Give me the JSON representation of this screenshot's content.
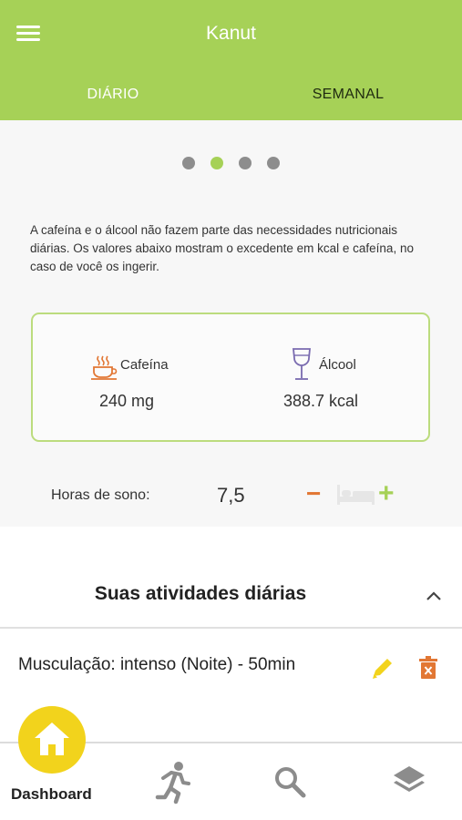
{
  "app": {
    "title": "Kanut"
  },
  "tabs": [
    {
      "label": "DIÁRIO",
      "active": true
    },
    {
      "label": "SEMANAL",
      "active": false
    }
  ],
  "carousel": {
    "page_count": 4,
    "active_index": 1
  },
  "intro_text": "A cafeína e o álcool não fazem parte das necessidades nutricionais diárias. Os valores abaixo mostram o excedente em kcal e cafeína, no caso de você os ingerir.",
  "intake_card": {
    "caffeine": {
      "label": "Cafeína",
      "value": "240 mg",
      "icon": "coffee-cup-icon"
    },
    "alcohol": {
      "label": "Álcool",
      "value": "388.7 kcal",
      "icon": "wine-glass-icon"
    }
  },
  "sleep": {
    "label": "Horas de sono:",
    "value": "7,5",
    "minus": "−",
    "plus": "+"
  },
  "activities": {
    "title": "Suas atividades diárias",
    "items": [
      {
        "text": "Musculação: intenso (Noite) - 50min"
      }
    ]
  },
  "bottom_nav": {
    "items": [
      {
        "label": "Dashboard",
        "icon": "home-icon",
        "active": true
      },
      {
        "icon": "running-icon"
      },
      {
        "icon": "search-icon"
      },
      {
        "icon": "layers-icon"
      }
    ]
  },
  "colors": {
    "primary": "#a6d157",
    "accent_orange": "#e27734",
    "accent_purple": "#7a6bb0",
    "fab_yellow": "#f2d31c"
  }
}
